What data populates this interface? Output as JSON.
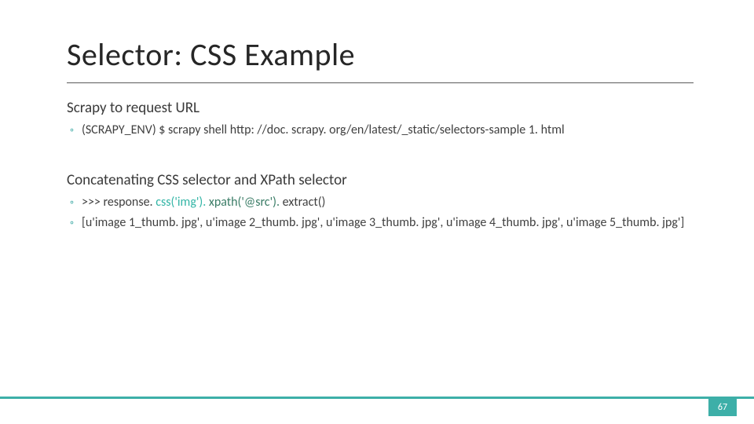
{
  "title": "Selector: CSS Example",
  "sections": {
    "s1": {
      "heading": "Scrapy to request URL",
      "bullet1": "(SCRAPY_ENV) $ scrapy shell http: //doc. scrapy. org/en/latest/_static/selectors-sample 1. html"
    },
    "s2": {
      "heading": "Concatenating  CSS selector and XPath selector",
      "bullet1_prefix": ">>> response. ",
      "bullet1_css": "css('img'). ",
      "bullet1_xpath": "xpath('@src'). ",
      "bullet1_suffix": "extract()",
      "bullet2": "[u'image 1_thumb. jpg', u'image 2_thumb. jpg', u'image 3_thumb. jpg', u'image 4_thumb. jpg', u'image 5_thumb. jpg']"
    }
  },
  "page_number": "67"
}
